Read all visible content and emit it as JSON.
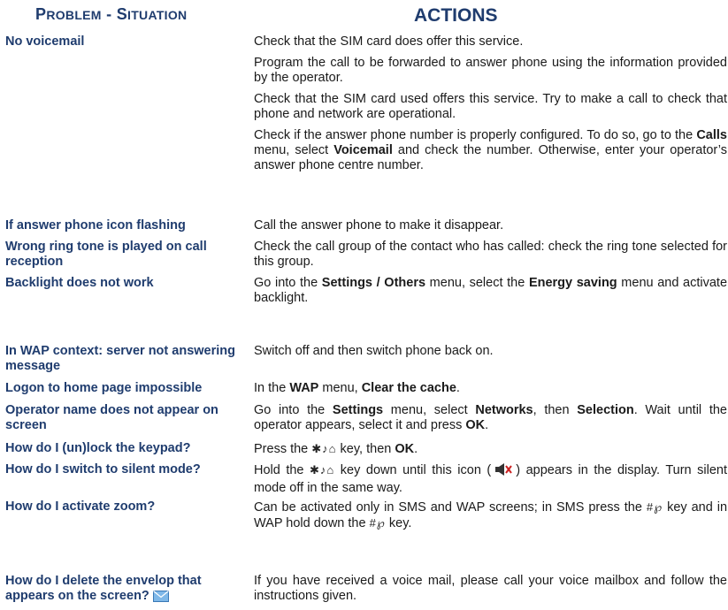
{
  "header": {
    "problem_first": "P",
    "problem_rest": "ROBLEM",
    "problem_sep": " - ",
    "situation_first": "S",
    "situation_rest": "ITUATION",
    "actions": "ACTIONS"
  },
  "rows": {
    "voicemail": {
      "problem": "No voicemail",
      "a1": "Check that the SIM card does offer this service.",
      "a2": "Program the call to be forwarded to answer phone using the information provided by the operator.",
      "a3": "Check that the SIM card used offers this service. Try to make a call to check that phone and network are operational.",
      "a4_pre": "Check if the answer phone number is properly configured. To do so, go to the ",
      "a4_b1": "Calls",
      "a4_mid1": " menu, select ",
      "a4_b2": "Voicemail",
      "a4_post": " and check the number. Otherwise, enter your operator’s answer phone centre number."
    },
    "flashing": {
      "problem": "If answer phone icon flashing",
      "action": "Call the answer phone to make it disappear."
    },
    "ringtone": {
      "problem": "Wrong ring tone is played on call reception",
      "action": "Check the call group of the contact who has called: check the ring tone selected for this group."
    },
    "backlight": {
      "problem": "Backlight does not work",
      "pre": "Go into the ",
      "b1": "Settings / Others",
      "mid": " menu, select the ",
      "b2": "Energy saving",
      "post": " menu and activate backlight."
    },
    "wap_server": {
      "problem": "In WAP context: server not answering message",
      "action": "Switch off and then switch phone back on."
    },
    "logon": {
      "problem": "Logon to home page impossible",
      "pre": "In the ",
      "b1": "WAP",
      "mid": " menu, ",
      "b2": "Clear the cache",
      "post": "."
    },
    "operator": {
      "problem": "Operator name does not appear on screen",
      "pre": "Go into the ",
      "b1": "Settings",
      "mid1": " menu, select ",
      "b2": "Networks",
      "mid2": ", then ",
      "b3": "Selection",
      "mid3": ". Wait until the operator appears, select it and press ",
      "b4": "OK",
      "post": "."
    },
    "unlock": {
      "problem": "How do I (un)lock the keypad?",
      "pre": "Press the ",
      "key": "✱♪⌂",
      "mid": " key, then ",
      "b1": "OK",
      "post": "."
    },
    "silent": {
      "problem": "How do I switch to silent mode?",
      "pre": "Hold the ",
      "key": "✱♪⌂",
      "mid": " key down until this icon (",
      "post": ") appears in the display. Turn silent mode off in the same way."
    },
    "zoom": {
      "problem": "How do I activate zoom?",
      "pre": "Can be activated only in SMS and WAP screens; in SMS press the ",
      "key1": "#℘",
      "mid": " key and in WAP hold down the ",
      "key2": "#℘",
      "post": " key."
    },
    "envelope": {
      "problem": "How do I delete the envelop that appears on the screen?",
      "action": "If you have received a voice mail, please call your voice mailbox and follow the instructions given."
    }
  },
  "icons": {
    "silent": "silent-mode-icon",
    "envelope": "envelope-icon"
  },
  "colors": {
    "heading": "#1f3c6e",
    "text": "#1a1a1a"
  }
}
